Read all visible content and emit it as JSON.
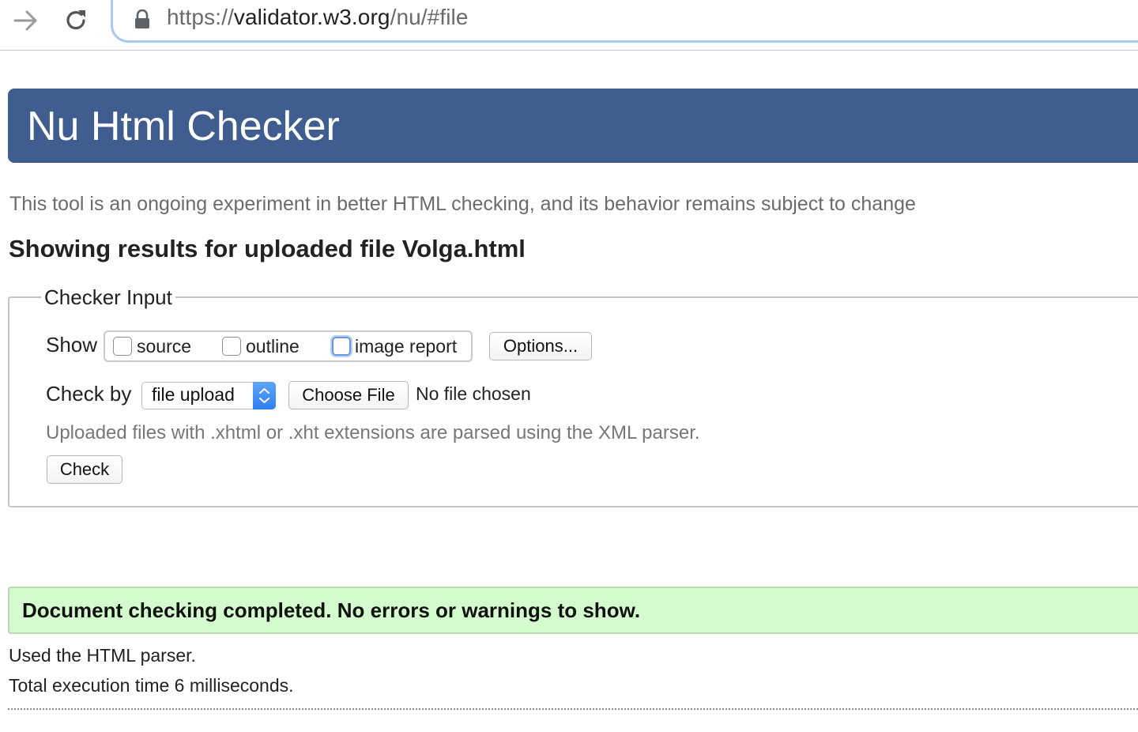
{
  "browser": {
    "url_scheme": "https://",
    "url_host": "validator.w3.org",
    "url_path": "/nu/#file",
    "icons": [
      "forward-arrow-icon",
      "reload-icon",
      "lock-icon"
    ]
  },
  "header": {
    "title": "Nu Html Checker",
    "color": "#3f5e8f"
  },
  "tagline": "This tool is an ongoing experiment in better HTML checking, and its behavior remains subject to change",
  "results_heading": "Showing results for uploaded file Volga.html",
  "checker_input": {
    "legend": "Checker Input",
    "show_label": "Show",
    "options": [
      {
        "label": "source",
        "checked": false
      },
      {
        "label": "outline",
        "checked": false
      },
      {
        "label": "image report",
        "checked": false
      }
    ],
    "options_button": "Options...",
    "check_by_label": "Check by",
    "check_by_value": "file upload",
    "choose_file_button": "Choose File",
    "file_status": "No file chosen",
    "hint": "Uploaded files with .xhtml or .xht extensions are parsed using the XML parser.",
    "check_button": "Check"
  },
  "result": {
    "message": "Document checking completed. No errors or warnings to show.",
    "color": "#d4fbcd"
  },
  "details": {
    "parser": "Used the HTML parser.",
    "execution_time": "Total execution time 6 milliseconds."
  }
}
